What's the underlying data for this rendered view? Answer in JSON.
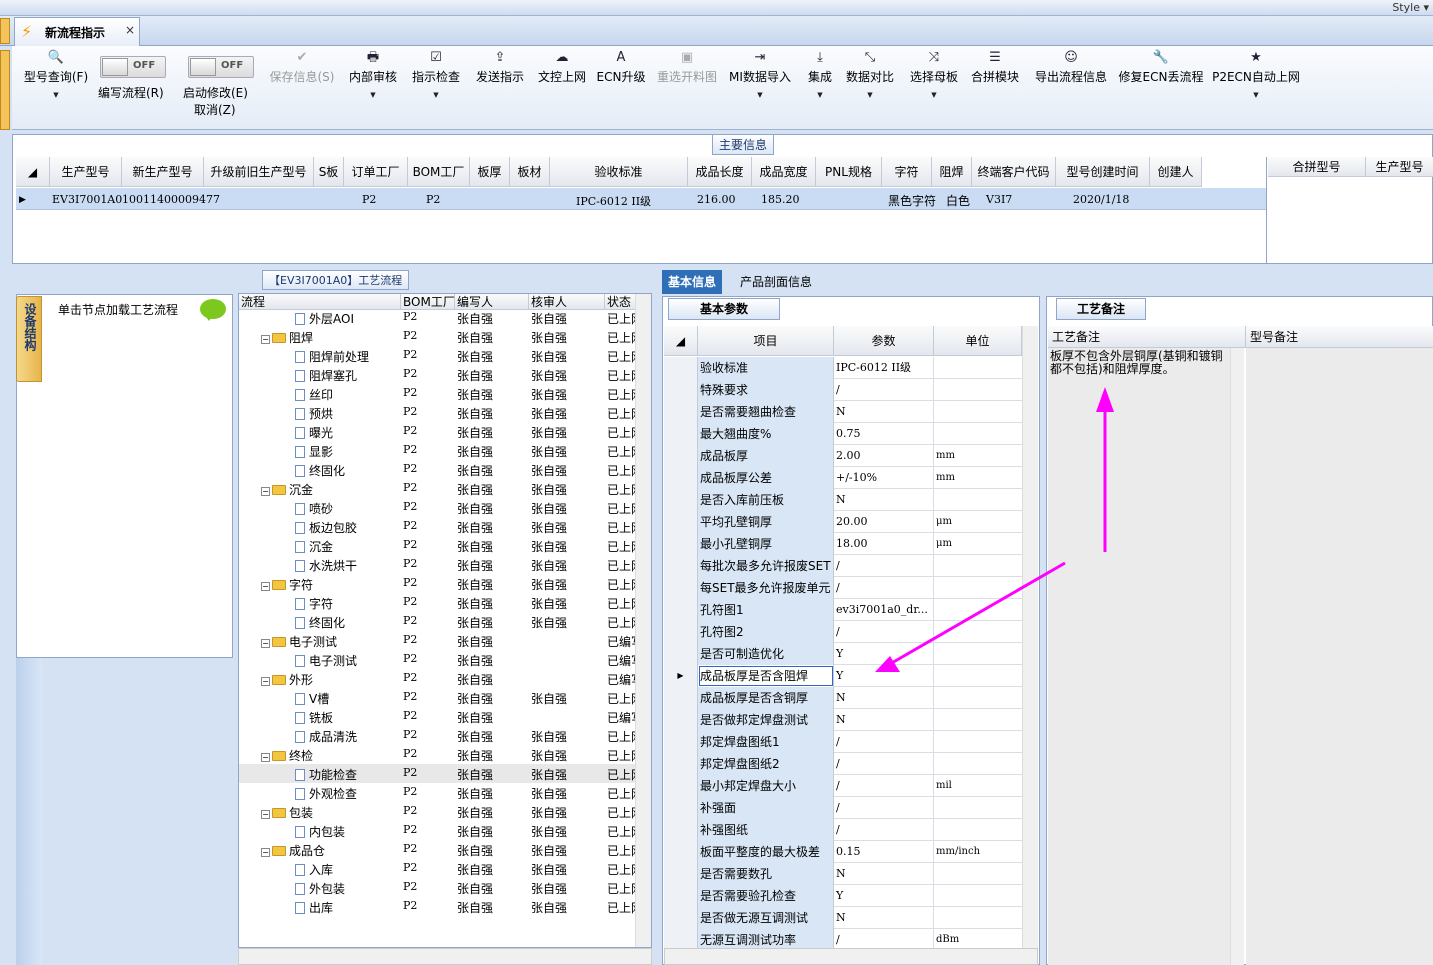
{
  "window": {
    "style_label": "Style"
  },
  "tab": {
    "title": "新流程指示",
    "close": "×"
  },
  "ribbon": {
    "buttons": [
      {
        "id": "model-query",
        "icon": "🔍",
        "label": "型号查询(F)",
        "dropdown": true,
        "disabled": false
      },
      {
        "id": "save-info",
        "icon": "✔",
        "label": "保存信息(S)",
        "dropdown": false,
        "disabled": true
      },
      {
        "id": "internal-review",
        "icon": "🖶",
        "label": "内部审核",
        "dropdown": true,
        "disabled": false
      },
      {
        "id": "instruction-check",
        "icon": "☑",
        "label": "指示检查",
        "dropdown": true,
        "disabled": false
      },
      {
        "id": "send-instruction",
        "icon": "⇪",
        "label": "发送指示",
        "dropdown": false,
        "disabled": false
      },
      {
        "id": "doc-control",
        "icon": "☁",
        "label": "文控上网",
        "dropdown": false,
        "disabled": false
      },
      {
        "id": "ecn-upgrade",
        "icon": "A",
        "label": "ECN升级",
        "dropdown": false,
        "disabled": false
      },
      {
        "id": "reselect-drawing",
        "icon": "▣",
        "label": "重选开料图",
        "dropdown": false,
        "disabled": true
      },
      {
        "id": "mi-import",
        "icon": "⇥",
        "label": "MI数据导入",
        "dropdown": true,
        "disabled": false
      },
      {
        "id": "integrate",
        "icon": "⤓",
        "label": "集成",
        "dropdown": true,
        "disabled": false
      },
      {
        "id": "data-compare",
        "icon": "⤡",
        "label": "数据对比",
        "dropdown": true,
        "disabled": false
      },
      {
        "id": "select-master",
        "icon": "⤨",
        "label": "选择母板",
        "dropdown": true,
        "disabled": false
      },
      {
        "id": "merge-module",
        "icon": "☰",
        "label": "合拼模块",
        "dropdown": false,
        "disabled": false
      },
      {
        "id": "export-flow",
        "icon": "☺",
        "label": "导出流程信息",
        "dropdown": false,
        "disabled": false
      },
      {
        "id": "repair-ecn",
        "icon": "🔧",
        "label": "修复ECN丢流程",
        "dropdown": false,
        "disabled": false
      },
      {
        "id": "p2ecn",
        "icon": "★",
        "label": "P2ECN自动上网",
        "dropdown": true,
        "disabled": false
      }
    ],
    "toggles": {
      "off_text": "OFF",
      "edit_flow": "编写流程(R)",
      "start_modify": "启动修改(E)",
      "cancel": "取消(Z)"
    }
  },
  "main_info": {
    "title": "主要信息",
    "columns": [
      "生产型号",
      "新生产型号",
      "升级前旧生产型号",
      "S板",
      "订单工厂",
      "BOM工厂",
      "板厚",
      "板材",
      "验收标准",
      "成品长度",
      "成品宽度",
      "PNL规格",
      "字符",
      "阻焊",
      "终端客户代码",
      "型号创建时间",
      "创建人"
    ],
    "row": {
      "prod_model": "EV3I7001A0",
      "new_model": "10011400009477",
      "order_factory": "P2",
      "bom_factory": "P2",
      "standard": "IPC-6012 II级",
      "length": "216.00",
      "width": "185.20",
      "char": "黑色字符",
      "solder": "白色",
      "customer": "V3I7",
      "created": "2020/1/18"
    },
    "merge_columns": [
      "合拼型号",
      "生产型号"
    ]
  },
  "device_panel": {
    "tab_label": "设备结构",
    "hint": "单击节点加载工艺流程"
  },
  "process": {
    "title": "【EV3I7001A0】工艺流程",
    "columns": [
      "流程",
      "BOM工厂",
      "编写人",
      "核审人",
      "状态"
    ],
    "rows": [
      {
        "n": "外层AOI",
        "lv": 2,
        "t": "doc",
        "b": "P2",
        "w": "张自强",
        "r": "张自强",
        "s": "已上网"
      },
      {
        "n": "阻焊",
        "lv": 1,
        "t": "folder",
        "b": "P2",
        "w": "张自强",
        "r": "张自强",
        "s": "已上网"
      },
      {
        "n": "阻焊前处理",
        "lv": 2,
        "t": "doc",
        "b": "P2",
        "w": "张自强",
        "r": "张自强",
        "s": "已上网"
      },
      {
        "n": "阻焊塞孔",
        "lv": 2,
        "t": "doc",
        "b": "P2",
        "w": "张自强",
        "r": "张自强",
        "s": "已上网"
      },
      {
        "n": "丝印",
        "lv": 2,
        "t": "doc",
        "b": "P2",
        "w": "张自强",
        "r": "张自强",
        "s": "已上网"
      },
      {
        "n": "预烘",
        "lv": 2,
        "t": "doc",
        "b": "P2",
        "w": "张自强",
        "r": "张自强",
        "s": "已上网"
      },
      {
        "n": "曝光",
        "lv": 2,
        "t": "doc",
        "b": "P2",
        "w": "张自强",
        "r": "张自强",
        "s": "已上网"
      },
      {
        "n": "显影",
        "lv": 2,
        "t": "doc",
        "b": "P2",
        "w": "张自强",
        "r": "张自强",
        "s": "已上网"
      },
      {
        "n": "终固化",
        "lv": 2,
        "t": "doc",
        "b": "P2",
        "w": "张自强",
        "r": "张自强",
        "s": "已上网"
      },
      {
        "n": "沉金",
        "lv": 1,
        "t": "folder",
        "b": "P2",
        "w": "张自强",
        "r": "张自强",
        "s": "已上网"
      },
      {
        "n": "喷砂",
        "lv": 2,
        "t": "doc",
        "b": "P2",
        "w": "张自强",
        "r": "张自强",
        "s": "已上网"
      },
      {
        "n": "板边包胶",
        "lv": 2,
        "t": "doc",
        "b": "P2",
        "w": "张自强",
        "r": "张自强",
        "s": "已上网"
      },
      {
        "n": "沉金",
        "lv": 2,
        "t": "doc",
        "b": "P2",
        "w": "张自强",
        "r": "张自强",
        "s": "已上网"
      },
      {
        "n": "水洗烘干",
        "lv": 2,
        "t": "doc",
        "b": "P2",
        "w": "张自强",
        "r": "张自强",
        "s": "已上网"
      },
      {
        "n": "字符",
        "lv": 1,
        "t": "folder",
        "b": "P2",
        "w": "张自强",
        "r": "张自强",
        "s": "已上网"
      },
      {
        "n": "字符",
        "lv": 2,
        "t": "doc",
        "b": "P2",
        "w": "张自强",
        "r": "张自强",
        "s": "已上网"
      },
      {
        "n": "终固化",
        "lv": 2,
        "t": "doc",
        "b": "P2",
        "w": "张自强",
        "r": "张自强",
        "s": "已上网"
      },
      {
        "n": "电子测试",
        "lv": 1,
        "t": "folder",
        "b": "P2",
        "w": "张自强",
        "r": "",
        "s": "已编写"
      },
      {
        "n": "电子测试",
        "lv": 2,
        "t": "doc",
        "b": "P2",
        "w": "张自强",
        "r": "",
        "s": "已编写"
      },
      {
        "n": "外形",
        "lv": 1,
        "t": "folder",
        "b": "P2",
        "w": "张自强",
        "r": "",
        "s": "已编写"
      },
      {
        "n": "V槽",
        "lv": 2,
        "t": "doc",
        "b": "P2",
        "w": "张自强",
        "r": "张自强",
        "s": "已上网"
      },
      {
        "n": "铣板",
        "lv": 2,
        "t": "doc",
        "b": "P2",
        "w": "张自强",
        "r": "",
        "s": "已编写"
      },
      {
        "n": "成品清洗",
        "lv": 2,
        "t": "doc",
        "b": "P2",
        "w": "张自强",
        "r": "张自强",
        "s": "已上网"
      },
      {
        "n": "终检",
        "lv": 1,
        "t": "folder",
        "b": "P2",
        "w": "张自强",
        "r": "张自强",
        "s": "已上网"
      },
      {
        "n": "功能检查",
        "lv": 2,
        "t": "doc",
        "b": "P2",
        "w": "张自强",
        "r": "张自强",
        "s": "已上网",
        "sel": true
      },
      {
        "n": "外观检查",
        "lv": 2,
        "t": "doc",
        "b": "P2",
        "w": "张自强",
        "r": "张自强",
        "s": "已上网"
      },
      {
        "n": "包装",
        "lv": 1,
        "t": "folder",
        "b": "P2",
        "w": "张自强",
        "r": "张自强",
        "s": "已上网"
      },
      {
        "n": "内包装",
        "lv": 2,
        "t": "doc",
        "b": "P2",
        "w": "张自强",
        "r": "张自强",
        "s": "已上网"
      },
      {
        "n": "成品仓",
        "lv": 1,
        "t": "folder",
        "b": "P2",
        "w": "张自强",
        "r": "张自强",
        "s": "已上网"
      },
      {
        "n": "入库",
        "lv": 2,
        "t": "doc",
        "b": "P2",
        "w": "张自强",
        "r": "张自强",
        "s": "已上网"
      },
      {
        "n": "外包装",
        "lv": 2,
        "t": "doc",
        "b": "P2",
        "w": "张自强",
        "r": "张自强",
        "s": "已上网"
      },
      {
        "n": "出库",
        "lv": 2,
        "t": "doc",
        "b": "P2",
        "w": "张自强",
        "r": "张自强",
        "s": "已上网"
      }
    ]
  },
  "right_tabs": {
    "basic": "基本信息",
    "profile": "产品剖面信息"
  },
  "basic_params": {
    "title": "基本参数",
    "columns": [
      "项目",
      "参数",
      "单位"
    ],
    "rows": [
      {
        "k": "验收标准",
        "v": "IPC-6012 II级",
        "u": ""
      },
      {
        "k": "特殊要求",
        "v": "/",
        "u": ""
      },
      {
        "k": "是否需要翘曲检查",
        "v": "N",
        "u": ""
      },
      {
        "k": "最大翘曲度%",
        "v": "0.75",
        "u": ""
      },
      {
        "k": "成品板厚",
        "v": "2.00",
        "u": "mm"
      },
      {
        "k": "成品板厚公差",
        "v": "+/-10%",
        "u": "mm"
      },
      {
        "k": "是否入库前压板",
        "v": "N",
        "u": ""
      },
      {
        "k": "平均孔壁铜厚",
        "v": "20.00",
        "u": "μm"
      },
      {
        "k": "最小孔壁铜厚",
        "v": "18.00",
        "u": "μm"
      },
      {
        "k": "每批次最多允许报废SET",
        "v": "/",
        "u": ""
      },
      {
        "k": "每SET最多允许报废单元",
        "v": "/",
        "u": ""
      },
      {
        "k": "孔符图1",
        "v": "ev3i7001a0_dr...",
        "u": ""
      },
      {
        "k": "孔符图2",
        "v": "/",
        "u": ""
      },
      {
        "k": "是否可制造优化",
        "v": "Y",
        "u": ""
      },
      {
        "k": "成品板厚是否含阻焊",
        "v": "Y",
        "u": "",
        "sel": true
      },
      {
        "k": "成品板厚是否含铜厚",
        "v": "N",
        "u": ""
      },
      {
        "k": "是否做邦定焊盘测试",
        "v": "N",
        "u": ""
      },
      {
        "k": "邦定焊盘图纸1",
        "v": "/",
        "u": ""
      },
      {
        "k": "邦定焊盘图纸2",
        "v": "/",
        "u": ""
      },
      {
        "k": "最小邦定焊盘大小",
        "v": "/",
        "u": "mil"
      },
      {
        "k": "补强面",
        "v": "/",
        "u": ""
      },
      {
        "k": "补强图纸",
        "v": "/",
        "u": ""
      },
      {
        "k": "板面平整度的最大极差",
        "v": "0.15",
        "u": "mm/inch"
      },
      {
        "k": "是否需要数孔",
        "v": "N",
        "u": ""
      },
      {
        "k": "是否需要验孔检查",
        "v": "Y",
        "u": ""
      },
      {
        "k": "是否做无源互调测试",
        "v": "N",
        "u": ""
      },
      {
        "k": "无源互调测试功率",
        "v": "/",
        "u": "dBm"
      }
    ]
  },
  "process_notes": {
    "tab": "工艺备注",
    "col1": "工艺备注",
    "col2": "型号备注",
    "text": "板厚不包含外层铜厚(基铜和镀铜都不包括)和阻焊厚度。"
  },
  "colors": {
    "accent": "#2f6fb7",
    "annotation_arrow": "#ff00ff",
    "selection_row": "#c9dcf3"
  }
}
